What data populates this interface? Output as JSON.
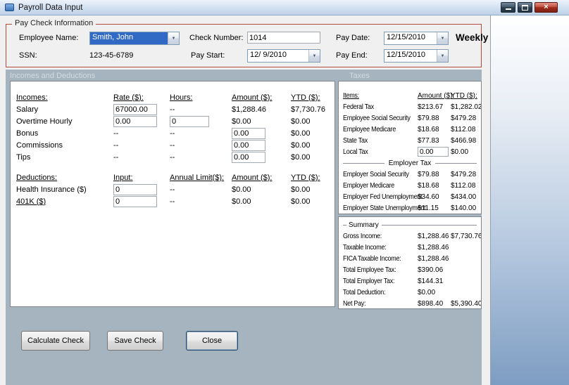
{
  "window": {
    "title": "Payroll Data Input"
  },
  "icons": {
    "dropdown": "▼",
    "close": "×"
  },
  "colors": {
    "groupbox_border": "#B14A3F",
    "selection_highlight": "#316AC5",
    "workspace_background": "#A6B4C0",
    "close_button": "#A02C1C"
  },
  "paycheck": {
    "section_title": "Pay Check Information",
    "employee_name": {
      "label": "Employee Name:",
      "value": "Smith, John"
    },
    "ssn": {
      "label": "SSN:",
      "value": "123-45-6789"
    },
    "check_number": {
      "label": "Check Number:",
      "value": "1014"
    },
    "pay_start": {
      "label": "Pay Start:",
      "value": "12/ 9/2010"
    },
    "pay_date": {
      "label": "Pay Date:",
      "value": "12/15/2010"
    },
    "pay_end": {
      "label": "Pay End:",
      "value": "12/15/2010"
    },
    "frequency": "Weekly"
  },
  "section_headers": {
    "incomes_deductions": "Incomes and Deductions",
    "taxes": "Taxes"
  },
  "incomes_table": {
    "headers": [
      "Incomes:",
      "Rate ($):",
      "Hours:",
      "Amount ($):",
      "YTD ($):"
    ],
    "rows": [
      {
        "label": "Salary",
        "cells": [
          {
            "t": "input",
            "v": "67000.00"
          },
          {
            "t": "text",
            "v": "--"
          },
          {
            "t": "text",
            "v": "$1,288.46"
          },
          {
            "t": "text",
            "v": "$7,730.76"
          }
        ]
      },
      {
        "label": "Overtime Hourly",
        "cells": [
          {
            "t": "input",
            "v": "0.00"
          },
          {
            "t": "input",
            "v": "0"
          },
          {
            "t": "text",
            "v": "$0.00"
          },
          {
            "t": "text",
            "v": "$0.00"
          }
        ]
      },
      {
        "label": "Bonus",
        "cells": [
          {
            "t": "text",
            "v": "--"
          },
          {
            "t": "text",
            "v": "--"
          },
          {
            "t": "input",
            "v": "0.00"
          },
          {
            "t": "text",
            "v": "$0.00"
          }
        ]
      },
      {
        "label": "Commissions",
        "cells": [
          {
            "t": "text",
            "v": "--"
          },
          {
            "t": "text",
            "v": "--"
          },
          {
            "t": "input",
            "v": "0.00"
          },
          {
            "t": "text",
            "v": "$0.00"
          }
        ]
      },
      {
        "label": "Tips",
        "cells": [
          {
            "t": "text",
            "v": "--"
          },
          {
            "t": "text",
            "v": "--"
          },
          {
            "t": "input",
            "v": "0.00"
          },
          {
            "t": "text",
            "v": "$0.00"
          }
        ]
      }
    ]
  },
  "deductions_table": {
    "headers": [
      "Deductions:",
      "Input:",
      "Annual Limit($):",
      "Amount ($):",
      "YTD ($):"
    ],
    "rows": [
      {
        "label": "Health Insurance  ($)",
        "underline": false,
        "cells": [
          {
            "t": "input",
            "v": "0"
          },
          {
            "t": "text",
            "v": "--"
          },
          {
            "t": "text",
            "v": "$0.00"
          },
          {
            "t": "text",
            "v": "$0.00"
          }
        ]
      },
      {
        "label": "401K  ($)",
        "underline": true,
        "cells": [
          {
            "t": "input",
            "v": "0"
          },
          {
            "t": "text",
            "v": "--"
          },
          {
            "t": "text",
            "v": "$0.00"
          },
          {
            "t": "text",
            "v": "$0.00"
          }
        ]
      }
    ]
  },
  "taxes_table": {
    "headers": [
      "Items:",
      "Amount ($):",
      "YTD ($):"
    ],
    "employee_rows": [
      {
        "label": "Federal Tax",
        "amount": {
          "t": "text",
          "v": "$213.67"
        },
        "ytd": "$1,282.02"
      },
      {
        "label": "Employee Social Security",
        "amount": {
          "t": "text",
          "v": "$79.88"
        },
        "ytd": "$479.28"
      },
      {
        "label": "Employee Medicare",
        "amount": {
          "t": "text",
          "v": "$18.68"
        },
        "ytd": "$112.08"
      },
      {
        "label": "State Tax",
        "amount": {
          "t": "text",
          "v": "$77.83"
        },
        "ytd": "$466.98"
      },
      {
        "label": "Local Tax",
        "amount": {
          "t": "input",
          "v": "0.00"
        },
        "ytd": "$0.00"
      }
    ],
    "employer_header": "Employer Tax",
    "employer_rows": [
      {
        "label": "Employer Social Security",
        "amount": {
          "t": "text",
          "v": "$79.88"
        },
        "ytd": "$479.28"
      },
      {
        "label": "Employer Medicare",
        "amount": {
          "t": "text",
          "v": "$18.68"
        },
        "ytd": "$112.08"
      },
      {
        "label": "Employer Fed Unemployment",
        "amount": {
          "t": "text",
          "v": "$34.60"
        },
        "ytd": "$434.00"
      },
      {
        "label": "Employer State Unemployment",
        "amount": {
          "t": "text",
          "v": "$11.15"
        },
        "ytd": "$140.00"
      }
    ]
  },
  "summary": {
    "title": "Summary",
    "rows": [
      {
        "label": "Gross Income:",
        "amount": "$1,288.46",
        "ytd": "$7,730.76"
      },
      {
        "label": "Taxable Income:",
        "amount": "$1,288.46",
        "ytd": ""
      },
      {
        "label": "FICA Taxable Income:",
        "amount": "$1,288.46",
        "ytd": ""
      },
      {
        "label": "Total Employee Tax:",
        "amount": "$390.06",
        "ytd": ""
      },
      {
        "label": "Total Employer Tax:",
        "amount": "$144.31",
        "ytd": ""
      },
      {
        "label": "Total Deduction:",
        "amount": "$0.00",
        "ytd": ""
      },
      {
        "label": "Net Pay:",
        "amount": "$898.40",
        "ytd": "$5,390.40"
      }
    ]
  },
  "buttons": {
    "calculate": "Calculate Check",
    "save": "Save Check",
    "close": "Close"
  }
}
